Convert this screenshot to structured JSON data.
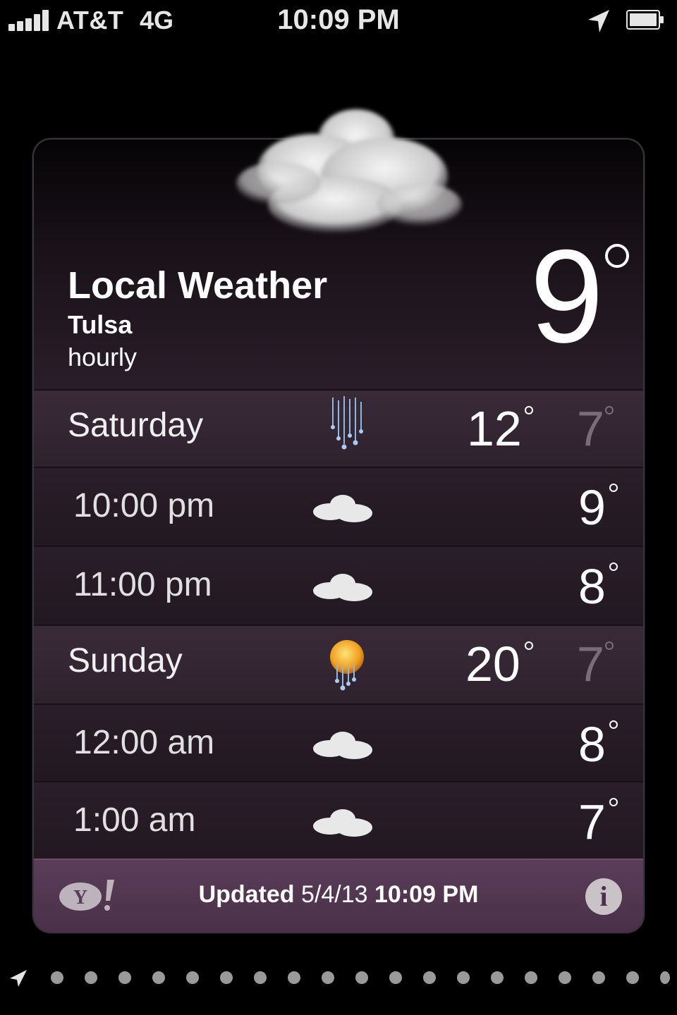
{
  "status_bar": {
    "carrier": "AT&T",
    "network": "4G",
    "time": "10:09 PM",
    "icons": [
      "signal-icon",
      "location-arrow-icon",
      "battery-icon"
    ]
  },
  "header": {
    "title": "Local Weather",
    "city": "Tulsa",
    "mode": "hourly",
    "current_temp": "9",
    "condition_icon": "cloudy-night-icon"
  },
  "rows": [
    {
      "type": "day",
      "label": "Saturday",
      "icon": "rain-icon",
      "high": "12",
      "low": "7"
    },
    {
      "type": "hour",
      "label": "10:00 pm",
      "icon": "cloud-icon",
      "temp": "9"
    },
    {
      "type": "hour",
      "label": "11:00 pm",
      "icon": "cloud-icon",
      "temp": "8"
    },
    {
      "type": "day",
      "label": "Sunday",
      "icon": "sun-rain-icon",
      "high": "20",
      "low": "7"
    },
    {
      "type": "hour",
      "label": "12:00 am",
      "icon": "cloud-icon",
      "temp": "8"
    },
    {
      "type": "hour",
      "label": "1:00 am",
      "icon": "cloud-icon",
      "temp": "7"
    }
  ],
  "footer": {
    "updated_label": "Updated",
    "updated_date": "5/4/13",
    "updated_time": "10:09 PM",
    "yahoo_logo": "yahoo-logo",
    "info_button": "info-icon"
  },
  "page_dots": {
    "count": 18,
    "current_location_icon": "location-arrow-icon"
  }
}
